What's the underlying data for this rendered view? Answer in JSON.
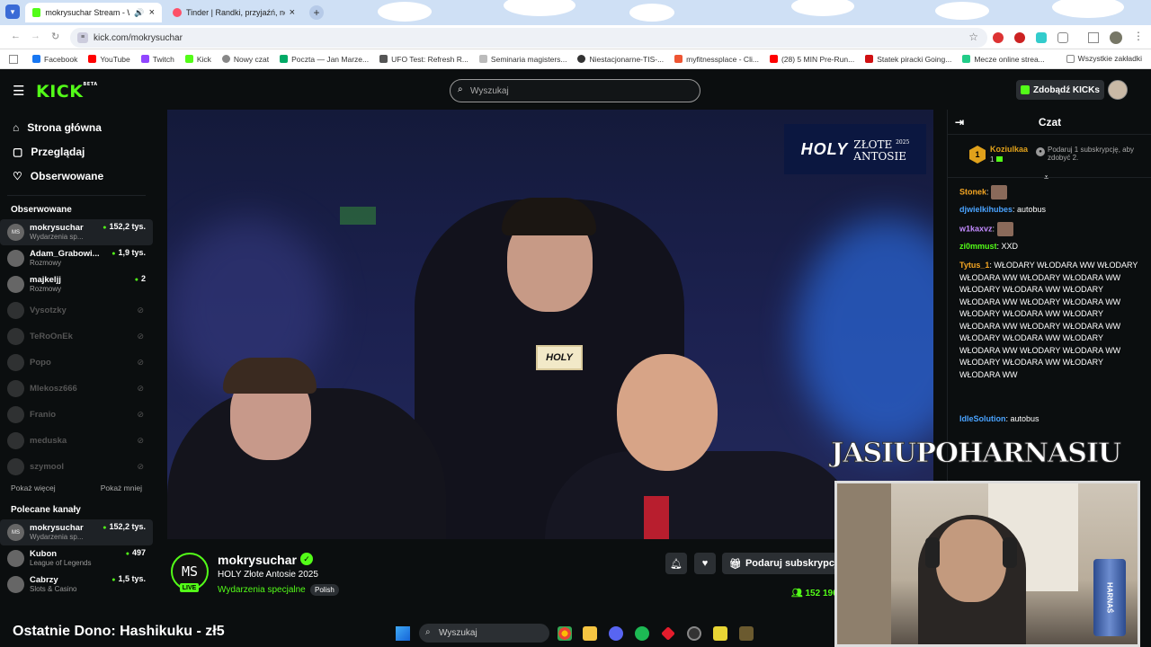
{
  "browser": {
    "tabs": [
      {
        "label": "mokrysuchar Stream - Wa..."
      },
      {
        "label": "Tinder | Randki, przyjaźń, nowe"
      }
    ],
    "url": "kick.com/mokrysuchar",
    "bookmarks": [
      "Facebook",
      "YouTube",
      "Twitch",
      "Kick",
      "Nowy czat",
      "Poczta — Jan Marze...",
      "UFO Test: Refresh R...",
      "Seminaria magisters...",
      "Niestacjonarne-TIS-...",
      "myfitnessplace - Cli...",
      "(28) 5 MIN Pre-Run...",
      "Statek piracki Going...",
      "Mecze online strea..."
    ],
    "all_bookmarks": "Wszystkie zakładki"
  },
  "header": {
    "logo": "KICK",
    "logo_beta": "BETA",
    "search_placeholder": "Wyszukaj",
    "get_kicks": "Zdobądź KICKs"
  },
  "sidebar": {
    "nav": [
      {
        "label": "Strona główna",
        "icon": "home-icon"
      },
      {
        "label": "Przeglądaj",
        "icon": "browse-icon"
      },
      {
        "label": "Obserwowane",
        "icon": "heart-icon"
      }
    ],
    "following_header": "Obserwowane",
    "following": [
      {
        "name": "mokrysuchar",
        "category": "Wydarzenia sp...",
        "viewers": "152,2 tys.",
        "live": true,
        "initials": "MS"
      },
      {
        "name": "Adam_Grabowi...",
        "category": "Rozmowy",
        "viewers": "1,9 tys.",
        "live": true,
        "initials": ""
      },
      {
        "name": "majkeljj",
        "category": "Rozmowy",
        "viewers": "2",
        "live": true,
        "initials": ""
      },
      {
        "name": "Vysotzky",
        "live": false
      },
      {
        "name": "TeRoOnEk",
        "live": false
      },
      {
        "name": "Popo",
        "live": false
      },
      {
        "name": "Mlekosz666",
        "live": false
      },
      {
        "name": "Franio",
        "live": false
      },
      {
        "name": "meduska",
        "live": false
      },
      {
        "name": "szymool",
        "live": false
      }
    ],
    "show_more": "Pokaż więcej",
    "show_less": "Pokaż mniej",
    "recommended_header": "Polecane kanały",
    "recommended": [
      {
        "name": "mokrysuchar",
        "category": "Wydarzenia sp...",
        "viewers": "152,2 tys.",
        "initials": "MS"
      },
      {
        "name": "Kubon",
        "category": "League of Legends",
        "viewers": "497"
      },
      {
        "name": "Cabrzy",
        "category": "Slots & Casino",
        "viewers": "1,5 tys."
      }
    ]
  },
  "stream": {
    "overlay_brand": "HOLY",
    "overlay_title_line1": "ZŁOTE",
    "overlay_title_line2": "ANTOSIE",
    "overlay_year": "2025",
    "mic_label": "HOLY",
    "channel_initials": "MS",
    "live_badge": "LIVE",
    "channel_name": "mokrysuchar",
    "title": "HOLY Złote Antosie 2025",
    "category": "Wydarzenia specjalne",
    "language": "Polish",
    "gift_button": "Podaruj subskrypcje",
    "viewers": "152 196"
  },
  "chat": {
    "header": "Czat",
    "pinned_user": "Koziulkaa",
    "pinned_rank": "1",
    "pinned_count": "1",
    "pinned_text": "Podaruj 1 subskrypcję, aby zdobyć 2.",
    "messages": [
      {
        "user": "Stonek",
        "text": "",
        "color": "#f5a623",
        "emote": true
      },
      {
        "user": "djwielkihubes",
        "text": "autobus",
        "color": "#4aa3ff"
      },
      {
        "user": "w1kaxvz",
        "text": "",
        "color": "#c38bff",
        "emote": true
      },
      {
        "user": "zi0mmust",
        "text": "XXD",
        "color": "#53fc18"
      },
      {
        "user": "Tytus_1",
        "text": "WŁODARY WŁODARA WW WŁODARY WŁODARA WW WŁODARY WŁODARA WW WŁODARY WŁODARA WW WŁODARY WŁODARA WW WŁODARY WŁODARA WW WŁODARY WŁODARA WW WŁODARY WŁODARA WW WŁODARY WŁODARA WW WŁODARY WŁODARA WW WŁODARY WŁODARA WW WŁODARY WŁODARA WW WŁODARY WŁODARA WW WŁODARY WŁODARA WW",
        "color": "#f5a623"
      },
      {
        "user": "IdleSolution",
        "text": "autobus",
        "color": "#4aa3ff"
      }
    ]
  },
  "overlay": {
    "cam_title": "JASIUPOHARNASIU",
    "can_label": "HARNAŚ",
    "donation": "Ostatnie Dono: Hashikuku - zł5"
  },
  "taskbar": {
    "search": "Wyszukaj"
  }
}
